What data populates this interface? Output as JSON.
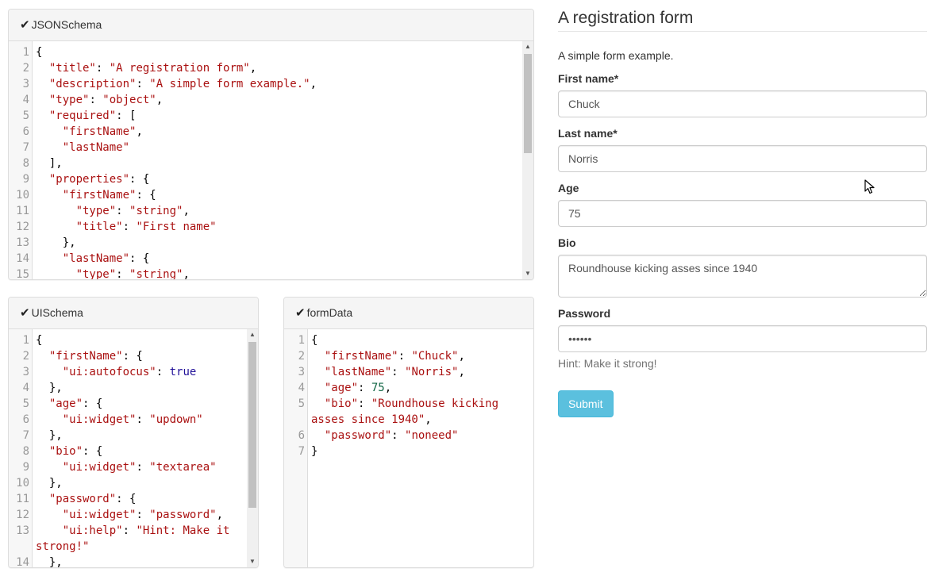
{
  "panels": {
    "jsonschema": {
      "title": "JSONSchema",
      "icon": "checkmark-icon",
      "lines": [
        {
          "n": "1",
          "segs": [
            [
              "p",
              "{"
            ]
          ]
        },
        {
          "n": "2",
          "segs": [
            [
              "p",
              "  "
            ],
            [
              "s",
              "\"title\""
            ],
            [
              "p",
              ": "
            ],
            [
              "s",
              "\"A registration form\""
            ],
            [
              "p",
              ","
            ]
          ]
        },
        {
          "n": "3",
          "segs": [
            [
              "p",
              "  "
            ],
            [
              "s",
              "\"description\""
            ],
            [
              "p",
              ": "
            ],
            [
              "s",
              "\"A simple form example.\""
            ],
            [
              "p",
              ","
            ]
          ]
        },
        {
          "n": "4",
          "segs": [
            [
              "p",
              "  "
            ],
            [
              "s",
              "\"type\""
            ],
            [
              "p",
              ": "
            ],
            [
              "s",
              "\"object\""
            ],
            [
              "p",
              ","
            ]
          ]
        },
        {
          "n": "5",
          "segs": [
            [
              "p",
              "  "
            ],
            [
              "s",
              "\"required\""
            ],
            [
              "p",
              ": ["
            ]
          ]
        },
        {
          "n": "6",
          "segs": [
            [
              "p",
              "    "
            ],
            [
              "s",
              "\"firstName\""
            ],
            [
              "p",
              ","
            ]
          ]
        },
        {
          "n": "7",
          "segs": [
            [
              "p",
              "    "
            ],
            [
              "s",
              "\"lastName\""
            ]
          ]
        },
        {
          "n": "8",
          "segs": [
            [
              "p",
              "  ],"
            ]
          ]
        },
        {
          "n": "9",
          "segs": [
            [
              "p",
              "  "
            ],
            [
              "s",
              "\"properties\""
            ],
            [
              "p",
              ": {"
            ]
          ]
        },
        {
          "n": "10",
          "segs": [
            [
              "p",
              "    "
            ],
            [
              "s",
              "\"firstName\""
            ],
            [
              "p",
              ": {"
            ]
          ]
        },
        {
          "n": "11",
          "segs": [
            [
              "p",
              "      "
            ],
            [
              "s",
              "\"type\""
            ],
            [
              "p",
              ": "
            ],
            [
              "s",
              "\"string\""
            ],
            [
              "p",
              ","
            ]
          ]
        },
        {
          "n": "12",
          "segs": [
            [
              "p",
              "      "
            ],
            [
              "s",
              "\"title\""
            ],
            [
              "p",
              ": "
            ],
            [
              "s",
              "\"First name\""
            ]
          ]
        },
        {
          "n": "13",
          "segs": [
            [
              "p",
              "    },"
            ]
          ]
        },
        {
          "n": "14",
          "segs": [
            [
              "p",
              "    "
            ],
            [
              "s",
              "\"lastName\""
            ],
            [
              "p",
              ": {"
            ]
          ]
        },
        {
          "n": "15",
          "segs": [
            [
              "p",
              "      "
            ],
            [
              "s",
              "\"type\""
            ],
            [
              "p",
              ": "
            ],
            [
              "s",
              "\"string\""
            ],
            [
              "p",
              ","
            ]
          ]
        }
      ]
    },
    "uischema": {
      "title": "UISchema",
      "icon": "checkmark-icon",
      "lines": [
        {
          "n": "1",
          "segs": [
            [
              "p",
              "{"
            ]
          ]
        },
        {
          "n": "2",
          "segs": [
            [
              "p",
              "  "
            ],
            [
              "s",
              "\"firstName\""
            ],
            [
              "p",
              ": {"
            ]
          ]
        },
        {
          "n": "3",
          "segs": [
            [
              "p",
              "    "
            ],
            [
              "s",
              "\"ui:autofocus\""
            ],
            [
              "p",
              ": "
            ],
            [
              "kw",
              "true"
            ]
          ]
        },
        {
          "n": "4",
          "segs": [
            [
              "p",
              "  },"
            ]
          ]
        },
        {
          "n": "5",
          "segs": [
            [
              "p",
              "  "
            ],
            [
              "s",
              "\"age\""
            ],
            [
              "p",
              ": {"
            ]
          ]
        },
        {
          "n": "6",
          "segs": [
            [
              "p",
              "    "
            ],
            [
              "s",
              "\"ui:widget\""
            ],
            [
              "p",
              ": "
            ],
            [
              "s",
              "\"updown\""
            ]
          ]
        },
        {
          "n": "7",
          "segs": [
            [
              "p",
              "  },"
            ]
          ]
        },
        {
          "n": "8",
          "segs": [
            [
              "p",
              "  "
            ],
            [
              "s",
              "\"bio\""
            ],
            [
              "p",
              ": {"
            ]
          ]
        },
        {
          "n": "9",
          "segs": [
            [
              "p",
              "    "
            ],
            [
              "s",
              "\"ui:widget\""
            ],
            [
              "p",
              ": "
            ],
            [
              "s",
              "\"textarea\""
            ]
          ]
        },
        {
          "n": "10",
          "segs": [
            [
              "p",
              "  },"
            ]
          ]
        },
        {
          "n": "11",
          "segs": [
            [
              "p",
              "  "
            ],
            [
              "s",
              "\"password\""
            ],
            [
              "p",
              ": {"
            ]
          ]
        },
        {
          "n": "12",
          "segs": [
            [
              "p",
              "    "
            ],
            [
              "s",
              "\"ui:widget\""
            ],
            [
              "p",
              ": "
            ],
            [
              "s",
              "\"password\""
            ],
            [
              "p",
              ","
            ]
          ]
        },
        {
          "n": "13",
          "segs": [
            [
              "p",
              "    "
            ],
            [
              "s",
              "\"ui:help\""
            ],
            [
              "p",
              ": "
            ],
            [
              "s",
              "\"Hint: Make it strong!\""
            ]
          ]
        },
        {
          "n": "14",
          "segs": [
            [
              "p",
              "  },"
            ]
          ]
        }
      ]
    },
    "formdata": {
      "title": "formData",
      "icon": "checkmark-icon",
      "lines": [
        {
          "n": "1",
          "segs": [
            [
              "p",
              "{"
            ]
          ]
        },
        {
          "n": "2",
          "segs": [
            [
              "p",
              "  "
            ],
            [
              "s",
              "\"firstName\""
            ],
            [
              "p",
              ": "
            ],
            [
              "s",
              "\"Chuck\""
            ],
            [
              "p",
              ","
            ]
          ]
        },
        {
          "n": "3",
          "segs": [
            [
              "p",
              "  "
            ],
            [
              "s",
              "\"lastName\""
            ],
            [
              "p",
              ": "
            ],
            [
              "s",
              "\"Norris\""
            ],
            [
              "p",
              ","
            ]
          ]
        },
        {
          "n": "4",
          "segs": [
            [
              "p",
              "  "
            ],
            [
              "s",
              "\"age\""
            ],
            [
              "p",
              ": "
            ],
            [
              "n",
              "75"
            ],
            [
              "p",
              ","
            ]
          ]
        },
        {
          "n": "5",
          "segs": [
            [
              "p",
              "  "
            ],
            [
              "s",
              "\"bio\""
            ],
            [
              "p",
              ": "
            ],
            [
              "s",
              "\"Roundhouse kicking asses since 1940\""
            ],
            [
              "p",
              ","
            ]
          ]
        },
        {
          "n": "6",
          "segs": [
            [
              "p",
              "  "
            ],
            [
              "s",
              "\"password\""
            ],
            [
              "p",
              ": "
            ],
            [
              "s",
              "\"noneed\""
            ]
          ]
        },
        {
          "n": "7",
          "segs": [
            [
              "p",
              "}"
            ]
          ]
        }
      ]
    }
  },
  "form": {
    "title": "A registration form",
    "description": "A simple form example.",
    "fields": {
      "first_name": {
        "label": "First name*",
        "value": "Chuck"
      },
      "last_name": {
        "label": "Last name*",
        "value": "Norris"
      },
      "age": {
        "label": "Age",
        "value": "75"
      },
      "bio": {
        "label": "Bio",
        "value": "Roundhouse kicking asses since 1940"
      },
      "password": {
        "label": "Password",
        "value": "noneed",
        "help": "Hint: Make it strong!"
      }
    },
    "submit_label": "Submit",
    "submit_color": "#5bc0de"
  }
}
